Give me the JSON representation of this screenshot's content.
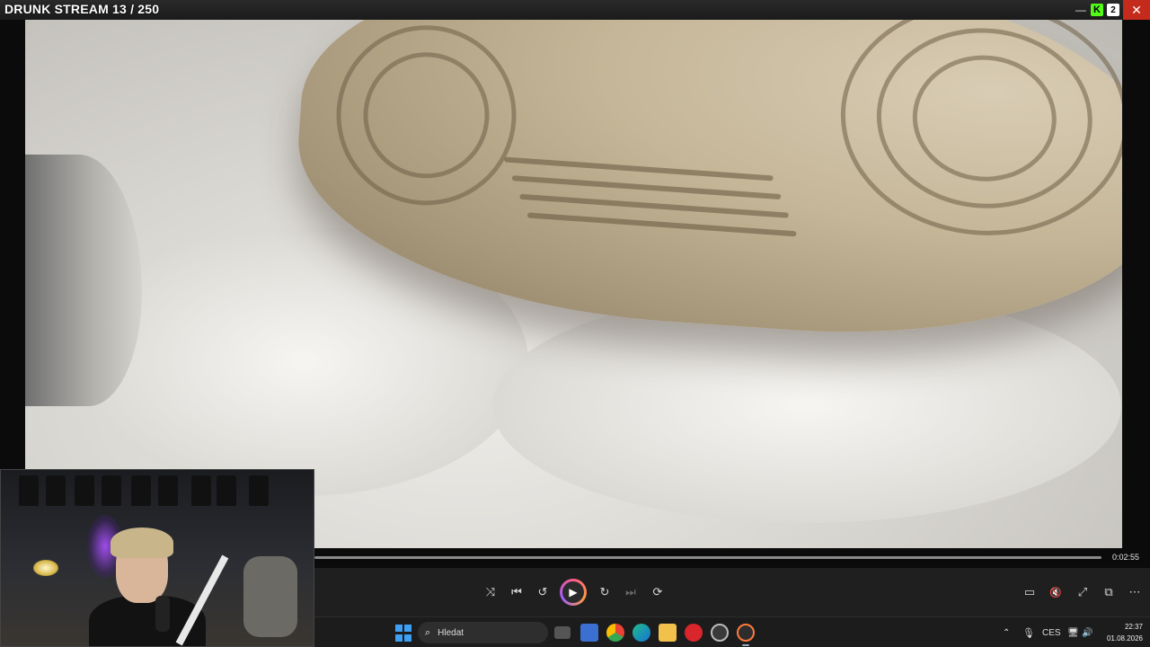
{
  "stream": {
    "title": "DRUNK STREAM 13 / 250"
  },
  "window_controls": {
    "kick_icon": "kick-logo-icon",
    "kick_letter": "K",
    "sub_letter": "2",
    "minimize": "—",
    "close": "✕"
  },
  "player": {
    "duration": "0:02:55",
    "buttons": {
      "shuffle": "⤨",
      "previous": "⏮",
      "rewind": "↺",
      "play": "▶",
      "forward": "↻",
      "next": "⏭",
      "repeat": "⟳",
      "subtitles": "▭",
      "mute": "🔇",
      "fullscreen": "⤢",
      "miniplayer": "⧉",
      "more": "⋯"
    }
  },
  "taskbar": {
    "search_placeholder": "Hledat",
    "search_icon": "⌕",
    "tray": {
      "chevron": "⌃",
      "mic": "🎙",
      "language": "CES",
      "network": "🖥",
      "volume": "🔊"
    },
    "time": "22:37",
    "date": "01.08.2026"
  },
  "colors": {
    "accent": "#3ea0f3",
    "close": "#c42b1c",
    "kick": "#53fc18"
  }
}
